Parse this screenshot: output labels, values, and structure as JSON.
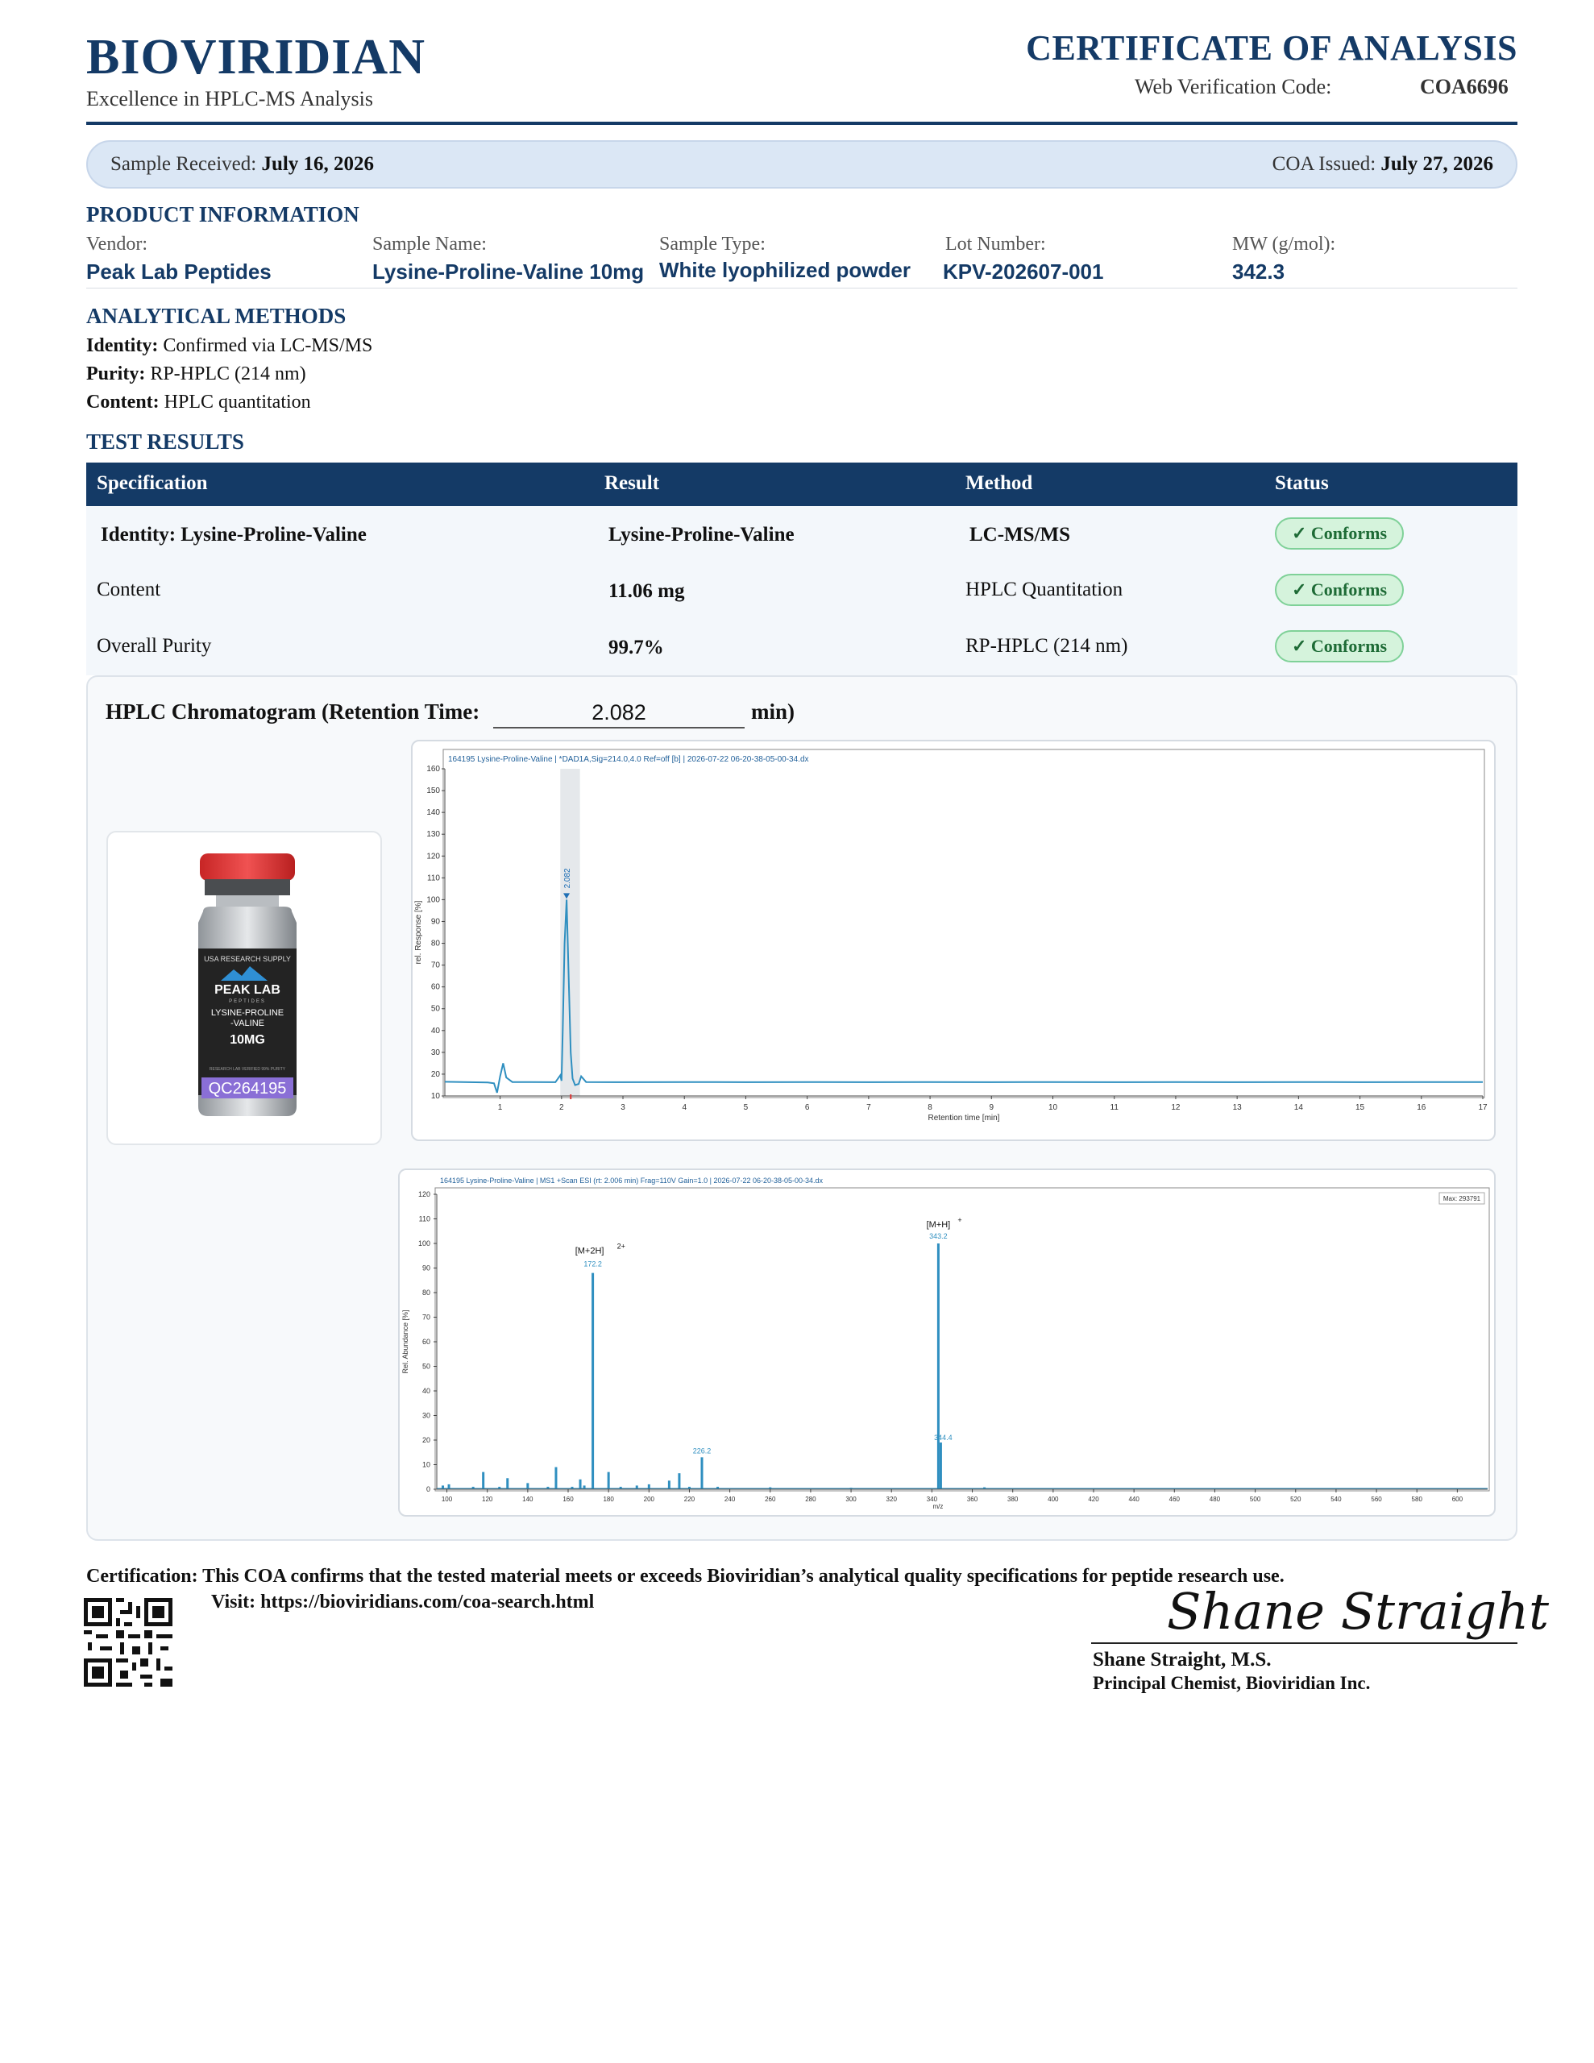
{
  "header": {
    "brand": "BIOVIRIDIAN",
    "tagline": "Excellence in HPLC-MS Analysis",
    "doc_title": "CERTIFICATE OF ANALYSIS",
    "verification_label": "Web Verification Code:",
    "verification_code": "COA6696"
  },
  "dates": {
    "received_label": "Sample Received:",
    "received_value": "July 16, 2026",
    "issued_label": "COA Issued:",
    "issued_value": "July 27, 2026"
  },
  "product_info": {
    "heading": "PRODUCT INFORMATION",
    "fields": [
      {
        "label": "Vendor:",
        "value": "Peak Lab Peptides"
      },
      {
        "label": "Sample Name:",
        "value": "Lysine-Proline-Valine 10mg"
      },
      {
        "label": "Sample Type:",
        "value": "White lyophilized powder"
      },
      {
        "label": "Lot Number:",
        "value": "KPV-202607-001"
      },
      {
        "label": "MW (g/mol):",
        "value": "342.3"
      }
    ]
  },
  "methods": {
    "heading": "ANALYTICAL METHODS",
    "lines": [
      {
        "label": "Identity:",
        "value": "Confirmed via LC-MS/MS"
      },
      {
        "label": "Purity:",
        "value": "RP-HPLC (214 nm)"
      },
      {
        "label": "Content:",
        "value": "HPLC quantitation"
      }
    ]
  },
  "results": {
    "heading": "TEST RESULTS",
    "columns": [
      "Specification",
      "Result",
      "Method",
      "Status"
    ],
    "rows": [
      {
        "spec": "Identity:  Lysine-Proline-Valine",
        "result": "Lysine-Proline-Valine",
        "method": "LC-MS/MS",
        "status": "✓ Conforms"
      },
      {
        "spec": "Content",
        "result": "11.06 mg",
        "method": "HPLC Quantitation",
        "status": "✓ Conforms"
      },
      {
        "spec": "Overall Purity",
        "result": "99.7%",
        "method": "RP-HPLC (214 nm)",
        "status": "✓ Conforms"
      }
    ]
  },
  "chromatogram_section": {
    "title_prefix": "HPLC Chromatogram (Retention Time:",
    "retention_time": "2.082",
    "title_suffix": "min)"
  },
  "vial": {
    "supply_text": "USA RESEARCH SUPPLY",
    "brand_line1": "PEAK LAB",
    "brand_line2": "PEPTIDES",
    "product_line1": "LYSINE-PROLINE",
    "product_line2": "-VALINE",
    "dose": "10MG",
    "fine_print": "RESEARCH LAB VERIFIED 99% PURITY",
    "qc_code": "QC264195"
  },
  "chart_data": [
    {
      "type": "line",
      "title": "164195 Lysine-Proline-Valine | *DAD1A,Sig=214.0,4.0 Ref=off [b] | 2026-07-22 06-20-38-05-00-34.dx",
      "xlabel": "Retention time [min]",
      "ylabel": "rel. Response [%]",
      "xlim": [
        0.1,
        17
      ],
      "ylim": [
        10,
        160
      ],
      "xticks": [
        1,
        2,
        3,
        4,
        5,
        6,
        7,
        8,
        9,
        10,
        11,
        12,
        13,
        14,
        15,
        16,
        17
      ],
      "yticks": [
        10,
        20,
        30,
        40,
        50,
        60,
        70,
        80,
        90,
        100,
        110,
        120,
        130,
        140,
        150,
        160
      ],
      "peak_label": "2.082",
      "series": [
        {
          "x": [
            0.1,
            0.8,
            0.9,
            0.95,
            1.0,
            1.05,
            1.1,
            1.2,
            1.5,
            1.9,
            1.98,
            2.0,
            2.02,
            2.05,
            2.082,
            2.12,
            2.15,
            2.18,
            2.22,
            2.28,
            2.32,
            2.4,
            3,
            4,
            5,
            6,
            7,
            8,
            9,
            10,
            11,
            12,
            13,
            14,
            15,
            16,
            17
          ],
          "y": [
            16.5,
            16.2,
            15.8,
            11.5,
            19,
            25,
            18.5,
            16.4,
            16.4,
            16.3,
            19.5,
            17,
            40,
            80,
            100,
            60,
            30,
            18,
            15,
            15.5,
            19,
            16.4,
            16.3,
            16.4,
            16.3,
            16.4,
            16.3,
            16.4,
            16.3,
            16.4,
            16.3,
            16.4,
            16.3,
            16.4,
            16.3,
            16.4,
            16.4
          ]
        }
      ]
    },
    {
      "type": "bar",
      "title": "164195 Lysine-Proline-Valine | MS1 +Scan ESI (rt: 2.006 min) Frag=110V Gain=1.0 | 2026-07-22 06-20-38-05-00-34.dx",
      "xlabel": "m/z",
      "ylabel": "Rel. Abundance [%]",
      "xlim": [
        95,
        615
      ],
      "ylim": [
        0,
        120
      ],
      "xticks": [
        100,
        120,
        140,
        160,
        180,
        200,
        220,
        240,
        260,
        280,
        300,
        320,
        340,
        360,
        380,
        400,
        420,
        440,
        460,
        480,
        500,
        520,
        540,
        560,
        580,
        600
      ],
      "yticks": [
        0,
        10,
        20,
        30,
        40,
        50,
        60,
        70,
        80,
        90,
        100,
        110,
        120
      ],
      "max_label": "Max: 293791",
      "annotations": [
        {
          "label": "[M+2H]",
          "sup": "2+",
          "mz_label": "172.2"
        },
        {
          "label": "[M+H]",
          "sup": "+",
          "mz_label": "343.2"
        },
        {
          "label": "",
          "sup": "",
          "mz_label": "226.2"
        },
        {
          "label": "",
          "sup": "",
          "mz_label": "344.4"
        }
      ],
      "peaks": [
        {
          "mz": 98,
          "value": 1.5
        },
        {
          "mz": 101,
          "value": 2
        },
        {
          "mz": 113,
          "value": 1
        },
        {
          "mz": 118,
          "value": 7
        },
        {
          "mz": 126,
          "value": 1
        },
        {
          "mz": 130,
          "value": 4.5
        },
        {
          "mz": 140,
          "value": 2.5
        },
        {
          "mz": 150,
          "value": 1
        },
        {
          "mz": 154,
          "value": 9
        },
        {
          "mz": 162,
          "value": 1
        },
        {
          "mz": 166,
          "value": 4
        },
        {
          "mz": 168,
          "value": 1.5
        },
        {
          "mz": 172.2,
          "value": 88
        },
        {
          "mz": 180,
          "value": 7
        },
        {
          "mz": 186,
          "value": 1
        },
        {
          "mz": 194,
          "value": 1.5
        },
        {
          "mz": 200,
          "value": 2
        },
        {
          "mz": 210,
          "value": 3.5
        },
        {
          "mz": 215,
          "value": 6.5
        },
        {
          "mz": 220,
          "value": 1
        },
        {
          "mz": 226.2,
          "value": 13
        },
        {
          "mz": 234,
          "value": 1
        },
        {
          "mz": 260,
          "value": 0.8
        },
        {
          "mz": 300,
          "value": 0.6
        },
        {
          "mz": 343.2,
          "value": 100
        },
        {
          "mz": 344.4,
          "value": 19
        },
        {
          "mz": 366,
          "value": 0.8
        }
      ]
    }
  ],
  "certification": {
    "text": "Certification: This COA confirms that the tested material meets or exceeds Bioviridian’s analytical quality specifications for peptide research use.",
    "visit": "Visit: https://bioviridians.com/coa-search.html"
  },
  "signature": {
    "script": "Shane Straight",
    "name": "Shane Straight, M.S.",
    "title": "Principal Chemist, Bioviridian Inc."
  },
  "colors": {
    "navy": "#143a66",
    "trace": "#2f8fc0",
    "conforms_bg": "#d5f3dc",
    "conforms_text": "#1e6b36",
    "vial_cap": "#e33b3b",
    "vial_label": "#222222",
    "qc_band": "#8a6fd6"
  }
}
